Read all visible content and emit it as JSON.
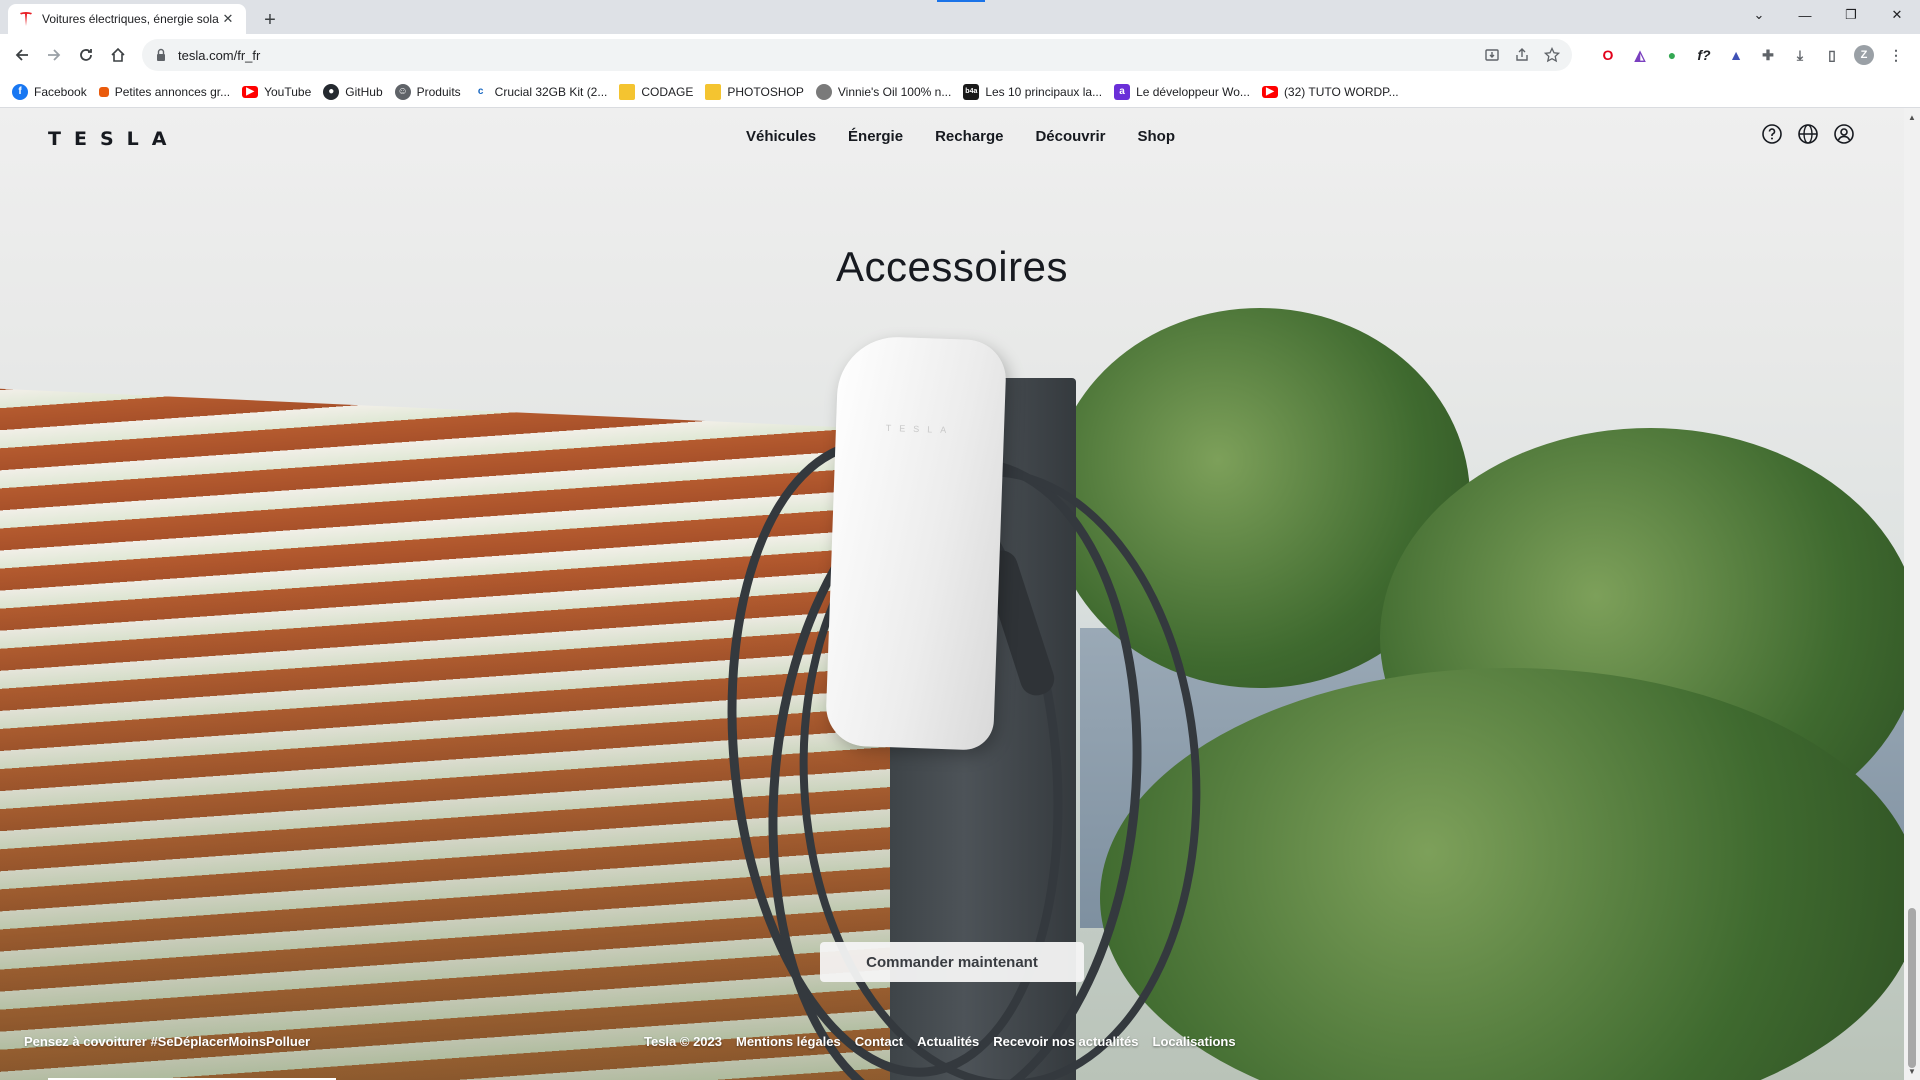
{
  "browser": {
    "tab_title": "Voitures électriques, énergie sola",
    "url": "tesla.com/fr_fr",
    "accent_color": "#1a73e8",
    "bookmarks": [
      {
        "label": "Facebook",
        "icon": "facebook-icon",
        "color": "#1877f2"
      },
      {
        "label": "Petites annonces gr...",
        "icon": "leboncoin-icon",
        "color": "#ea5b0c"
      },
      {
        "label": "YouTube",
        "icon": "youtube-icon",
        "color": "#ff0000"
      },
      {
        "label": "GitHub",
        "icon": "github-icon",
        "color": "#24292f"
      },
      {
        "label": "Produits",
        "icon": "produits-icon",
        "color": "#5f6368"
      },
      {
        "label": "Crucial 32GB Kit (2...",
        "icon": "crucial-icon",
        "color": "#1565c0"
      },
      {
        "label": "CODAGE",
        "icon": "folder-icon",
        "color": "#f4c430"
      },
      {
        "label": "PHOTOSHOP",
        "icon": "folder-icon",
        "color": "#f4c430"
      },
      {
        "label": "Vinnie's Oil 100% n...",
        "icon": "vinnies-icon",
        "color": "#7a7a7a"
      },
      {
        "label": "Les 10 principaux la...",
        "icon": "b4a-icon",
        "color": "#1a1a1a"
      },
      {
        "label": "Le développeur Wo...",
        "icon": "dev-icon",
        "color": "#6a2fd8"
      },
      {
        "label": "(32) TUTO WORDP...",
        "icon": "youtube-icon",
        "color": "#ff0000"
      }
    ]
  },
  "tesla": {
    "logo": "TESLA",
    "nav": [
      "Véhicules",
      "Énergie",
      "Recharge",
      "Découvrir",
      "Shop"
    ],
    "title": "Accessoires",
    "cta": "Commander maintenant",
    "footer_left": "Pensez à covoiturer #SeDéplacerMoinsPolluer",
    "footer_links": [
      "Tesla © 2023",
      "Mentions légales",
      "Contact",
      "Actualités",
      "Recevoir nos actualités",
      "Localisations"
    ],
    "charger_brand": "TESLA"
  }
}
